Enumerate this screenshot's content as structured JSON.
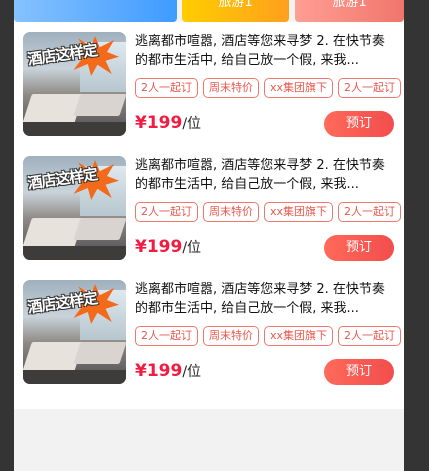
{
  "header": {
    "tabs": [
      {
        "label": ""
      },
      {
        "label": "旅游1"
      },
      {
        "label": "旅游1"
      }
    ]
  },
  "colors": {
    "accent": "#f24d4d",
    "price": "#f21b42",
    "tag_border": "#f0776d",
    "background": "#f2f2f2"
  },
  "products": [
    {
      "thumb_text": "酒店这样定",
      "title": "逃离都市喧嚣, 酒店等您来寻梦 2. 在快节奏的都市生活中, 给自己放一个假, 来我...",
      "tags": [
        "2人一起订",
        "周末特价",
        "xx集团旗下",
        "2人一起订"
      ],
      "price": "¥199",
      "unit": "/位",
      "button": "预订"
    },
    {
      "thumb_text": "酒店这样定",
      "title": "逃离都市喧嚣, 酒店等您来寻梦 2. 在快节奏的都市生活中, 给自己放一个假, 来我...",
      "tags": [
        "2人一起订",
        "周末特价",
        "xx集团旗下",
        "2人一起订"
      ],
      "price": "¥199",
      "unit": "/位",
      "button": "预订"
    },
    {
      "thumb_text": "酒店这样定",
      "title": "逃离都市喧嚣, 酒店等您来寻梦 2. 在快节奏的都市生活中, 给自己放一个假, 来我...",
      "tags": [
        "2人一起订",
        "周末特价",
        "xx集团旗下",
        "2人一起订"
      ],
      "price": "¥199",
      "unit": "/位",
      "button": "预订"
    }
  ]
}
